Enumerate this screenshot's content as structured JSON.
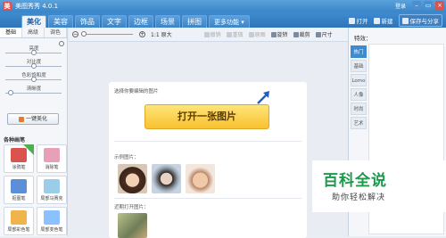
{
  "window": {
    "logo_text": "美",
    "title": "美图秀秀 4.0.1",
    "login": "登录",
    "btn_restore": "▭",
    "btn_min": "–",
    "btn_close": "×"
  },
  "tabs": [
    "美化",
    "美容",
    "饰品",
    "文字",
    "边框",
    "场景",
    "拼图",
    "更多功能 ▾"
  ],
  "active_tab": "美化",
  "right_tools": {
    "open": "打开",
    "new": "新建",
    "save": "保存与分享"
  },
  "subtabs": [
    "基础",
    "高级",
    "调色"
  ],
  "sliders": [
    {
      "label": "亮度",
      "value": 0.5
    },
    {
      "label": "对比度",
      "value": 0.5
    },
    {
      "label": "色彩饱和度",
      "value": 0.5
    },
    {
      "label": "清晰度",
      "value": 0.05
    }
  ],
  "one_key_label": "一键美化",
  "brush_section_title": "各种画笔",
  "brushes": [
    {
      "label": "涂鸦笔",
      "icon": "pencil-icon",
      "color": "#d9534f"
    },
    {
      "label": "消除笔",
      "icon": "eraser-icon",
      "color": "#e8a0b8"
    },
    {
      "label": "抠图笔",
      "icon": "scissors-icon",
      "color": "#5b8fd8"
    },
    {
      "label": "局部马赛克",
      "icon": "mosaic-icon",
      "color": "#9acde8"
    },
    {
      "label": "局部彩色笔",
      "icon": "paintbrush-icon",
      "color": "#f0b44c"
    },
    {
      "label": "局部变色笔",
      "icon": "color-change-icon",
      "color": "#8bc1ff"
    }
  ],
  "toolbar": {
    "zoom_minus": "−",
    "zoom_plus": "+",
    "actual_size": "1:1 原大",
    "undo": "撤销",
    "redo": "重做",
    "original": "原图",
    "rotate": "旋转",
    "crop": "裁剪",
    "size": "尺寸"
  },
  "canvas": {
    "hint": "选择你要编辑的图片",
    "open_button": "打开一张图片",
    "sample_label": "示例图片：",
    "recent_label": "近期打开图片："
  },
  "right_panel": {
    "title": "特效：",
    "categories": [
      "热门",
      "基础",
      "Lomo",
      "人像",
      "时尚",
      "艺术"
    ],
    "active": "热门"
  },
  "watermark": {
    "title": "百科全说",
    "subtitle": "助你轻松解决"
  }
}
